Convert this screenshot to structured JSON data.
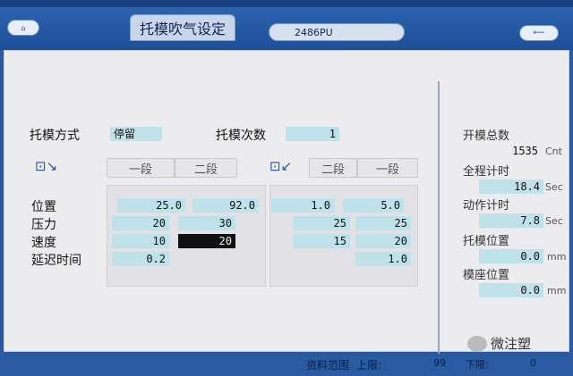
{
  "header": {
    "title": "托模吹气设定",
    "mold_number": "2486PU",
    "left_button": "⌂",
    "exit_button": "⟵"
  },
  "ejector": {
    "mode_label": "托模方式",
    "mode_value": "停留",
    "count_label": "托模次数",
    "count_value": "1"
  },
  "segments": {
    "left_tabs": [
      "一段",
      "二段"
    ],
    "right_tabs": [
      "二段",
      "一段"
    ]
  },
  "rows": {
    "position_label": "位置",
    "pressure_label": "压力",
    "speed_label": "速度",
    "delay_label": "延迟时间"
  },
  "forward": {
    "seg1": {
      "position": "25.0",
      "pressure": "20",
      "speed": "10",
      "delay": "0.2"
    },
    "seg2": {
      "position": "92.0",
      "pressure": "30",
      "speed": "20"
    }
  },
  "backward": {
    "seg2": {
      "position": "1.0",
      "pressure": "25",
      "speed": "15"
    },
    "seg1": {
      "position": "5.0",
      "pressure": "25",
      "speed": "20",
      "delay": "1.0"
    }
  },
  "stats": {
    "open_total_label": "开模总数",
    "open_total_value": "1535",
    "open_total_unit": "Cnt",
    "cycle_time_label": "全程计时",
    "cycle_time_value": "18.4",
    "cycle_time_unit": "Sec",
    "action_time_label": "动作计时",
    "action_time_value": "7.8",
    "action_time_unit": "Sec",
    "ejector_pos_label": "托模位置",
    "ejector_pos_value": "0.0",
    "ejector_pos_unit": "mm",
    "platen_pos_label": "模座位置",
    "platen_pos_value": "0.0",
    "platen_pos_unit": "mm"
  },
  "footer": {
    "range_label": "资料范围",
    "upper_label": "上限:",
    "upper_value": "99",
    "lower_label": "下限:",
    "lower_value": "0"
  },
  "watermark": "微注塑"
}
